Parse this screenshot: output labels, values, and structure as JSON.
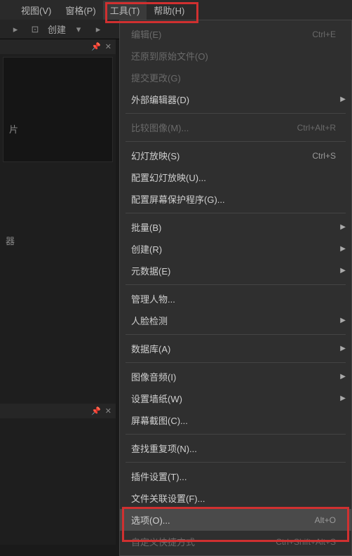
{
  "menubar": {
    "view": "视图(V)",
    "grid": "窗格(P)",
    "tools": "工具(T)",
    "help": "帮助(H)"
  },
  "toolbar": {
    "create": "创建"
  },
  "sidepanel": {
    "text1": "片",
    "text2": "器"
  },
  "menu": {
    "edit": {
      "label": "编辑(E)",
      "shortcut": "Ctrl+E"
    },
    "revert": {
      "label": "还原到原始文件(O)"
    },
    "commit": {
      "label": "提交更改(G)"
    },
    "external_editor": {
      "label": "外部编辑器(D)"
    },
    "compare_images": {
      "label": "比较图像(M)...",
      "shortcut": "Ctrl+Alt+R"
    },
    "slideshow": {
      "label": "幻灯放映(S)",
      "shortcut": "Ctrl+S"
    },
    "config_slideshow": {
      "label": "配置幻灯放映(U)..."
    },
    "config_screensaver": {
      "label": "配置屏幕保护程序(G)..."
    },
    "batch": {
      "label": "批量(B)"
    },
    "create": {
      "label": "创建(R)"
    },
    "metadata": {
      "label": "元数据(E)"
    },
    "manage_people": {
      "label": "管理人物..."
    },
    "face_detect": {
      "label": "人脸检测"
    },
    "database": {
      "label": "数据库(A)"
    },
    "image_audio": {
      "label": "图像音频(I)"
    },
    "set_wallpaper": {
      "label": "设置墙纸(W)"
    },
    "screenshot": {
      "label": "屏幕截图(C)..."
    },
    "find_dup": {
      "label": "查找重复项(N)..."
    },
    "plugin_settings": {
      "label": "插件设置(T)..."
    },
    "file_assoc": {
      "label": "文件关联设置(F)..."
    },
    "options": {
      "label": "选项(O)...",
      "shortcut": "Alt+O"
    },
    "custom_shortcut": {
      "label": "自定义快捷方式",
      "shortcut": "Ctrl+Shift+Alt+S"
    }
  }
}
